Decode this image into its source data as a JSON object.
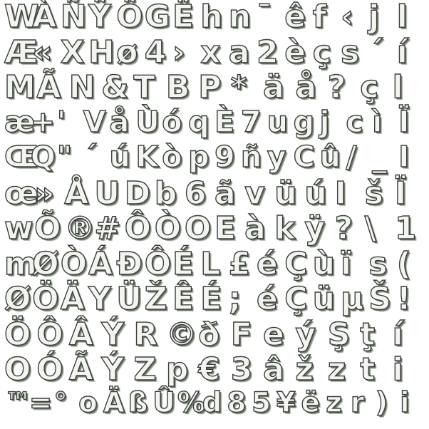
{
  "glyph_sheet": {
    "rows": [
      [
        "W",
        "À",
        "Ñ",
        "Ÿ",
        "Ö",
        "G",
        "Ë",
        "h",
        "n",
        "¯",
        "ê",
        "f",
        "‹",
        "j",
        "l"
      ],
      [
        "Æ",
        "«",
        "X",
        "H",
        "ø",
        "4",
        "›",
        "x",
        "a",
        "2",
        "è",
        "ç",
        "s",
        "´",
        "í"
      ],
      [
        "M",
        "Ã",
        "N",
        "&",
        "T",
        "B",
        "P",
        "*",
        "ä",
        "å",
        "?",
        "ç",
        "l"
      ],
      [
        "æ",
        "+",
        "'",
        "V",
        "å",
        "Ù",
        "ó",
        "q",
        "È",
        "7",
        "u",
        "g",
        "j",
        "c",
        "ì",
        "Ï"
      ],
      [
        "Œ",
        "Q",
        "\"",
        "´",
        "ú",
        "K",
        "ò",
        "p",
        "9",
        "ñ",
        "y",
        "C",
        "û",
        "/",
        "_",
        "I"
      ],
      [
        "œ",
        "»",
        "Å",
        "U",
        "D",
        "b",
        "6",
        "ã",
        "v",
        "ü",
        "ú",
        "I",
        "š",
        "Ï"
      ],
      [
        "w",
        "Õ",
        "®",
        "#",
        "Ô",
        "Ò",
        "O",
        "E",
        "à",
        "k",
        "ÿ",
        "?",
        "\\",
        "1"
      ],
      [
        "m",
        "Ø",
        "Ò",
        "Á",
        "Đ",
        "Ô",
        "É",
        "L",
        "£",
        "é",
        "Ç",
        "ù",
        "ï",
        "s",
        "("
      ],
      [
        "Ø",
        "Ö",
        "Ä",
        "Y",
        "Ü",
        "Ž",
        "Ê",
        "É",
        ";",
        "é",
        "Ç",
        "ü",
        "µ",
        "Š",
        "!"
      ],
      [
        "Ö",
        "Ô",
        "Â",
        "Ý",
        "R",
        "©",
        "ð",
        "F",
        "e",
        "ý",
        "Ş",
        "ţ",
        "í"
      ],
      [
        "O",
        "Ó",
        "Ã",
        "Ý",
        "Z",
        "p",
        "€",
        "3",
        "â",
        "ž",
        "z",
        "t",
        "i"
      ],
      [
        "™",
        "=",
        "°",
        "o",
        "Ä",
        "ß",
        "Û",
        "%",
        "d",
        "8",
        "5",
        "¥",
        "ë",
        "z",
        "r",
        ")",
        "i"
      ]
    ]
  }
}
